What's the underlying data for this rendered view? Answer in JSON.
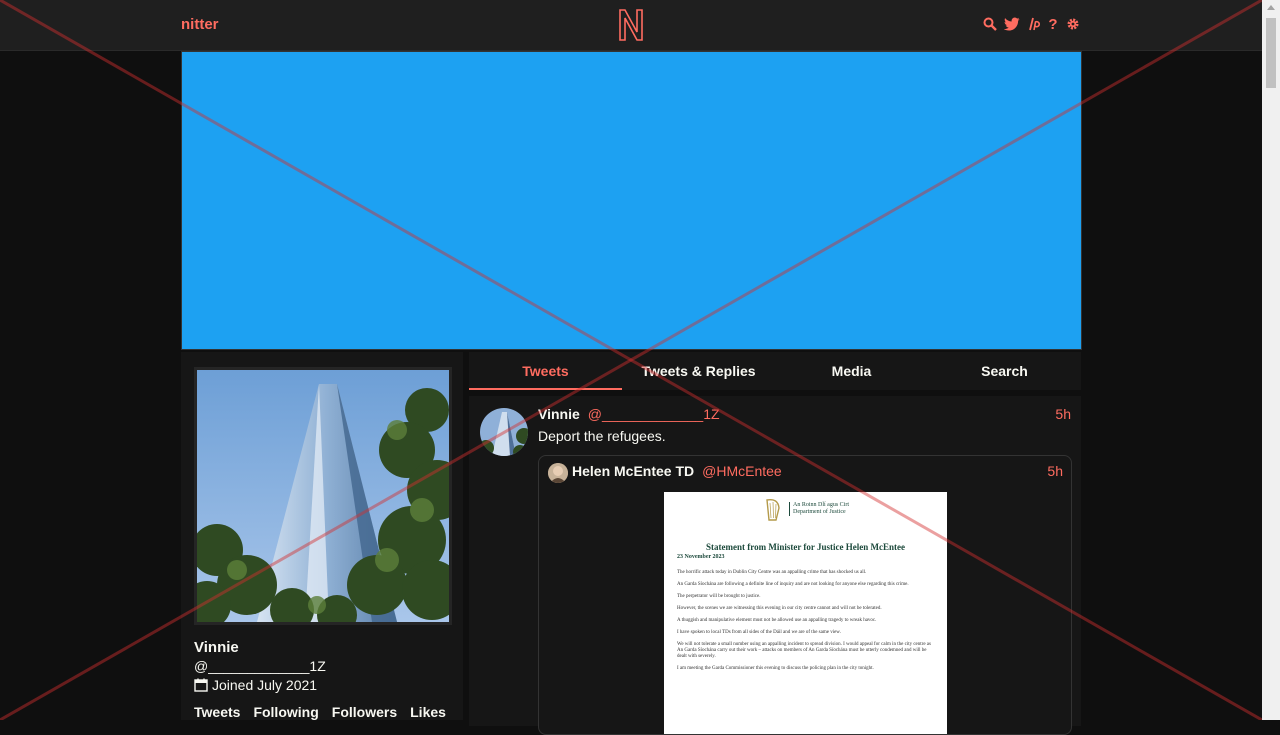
{
  "nav": {
    "brand": "nitter",
    "help_label": "?"
  },
  "banner": {
    "color": "#1da1f2"
  },
  "profile": {
    "fullname": "Vinnie",
    "username": "@_____________1Z",
    "joined": "Joined July 2021",
    "stats": [
      "Tweets",
      "Following",
      "Followers",
      "Likes"
    ]
  },
  "tabs": [
    "Tweets",
    "Tweets & Replies",
    "Media",
    "Search"
  ],
  "tweet": {
    "fullname": "Vinnie",
    "username": "@_____________1Z",
    "date": "5h",
    "text": "Deport the refugees.",
    "quote": {
      "fullname": "Helen McEntee TD",
      "username": "@HMcEntee",
      "date": "5h",
      "attachment": {
        "dept_ga": "An Roinn Dlí agus Cirt",
        "dept_en": "Department of Justice",
        "title": "Statement from Minister for Justice Helen McEntee",
        "date": "23 November 2023",
        "paragraphs": [
          "The horrific attack today in Dublin City Centre was an appalling crime that has shocked us all.",
          "An Garda Síochána are following a definite line of inquiry and are not looking for anyone else regarding this crime.",
          "The perpetrator will be brought to justice.",
          "However, the scenes we are witnessing this evening in our city centre cannot and will not be tolerated.",
          "A thuggish and manipulative element must not be allowed use an appalling tragedy to wreak havoc.",
          "I have spoken to local TDs from all sides of the Dáil and we are of the same view.",
          "We will not tolerate a small number using an appalling incident to spread division. I would appeal for calm in the city centre as An Garda Síochána carry out their work – attacks on members of An Garda Síochána must be utterly condemned and will be dealt with severely.",
          "I am meeting the Garda Commissioner this evening to discuss the policing plan in the city tonight."
        ]
      }
    }
  },
  "colors": {
    "accent": "#ff6c60",
    "background": "#0f0f0f",
    "panel": "#161616",
    "overlay_x": "#d32f2f"
  }
}
